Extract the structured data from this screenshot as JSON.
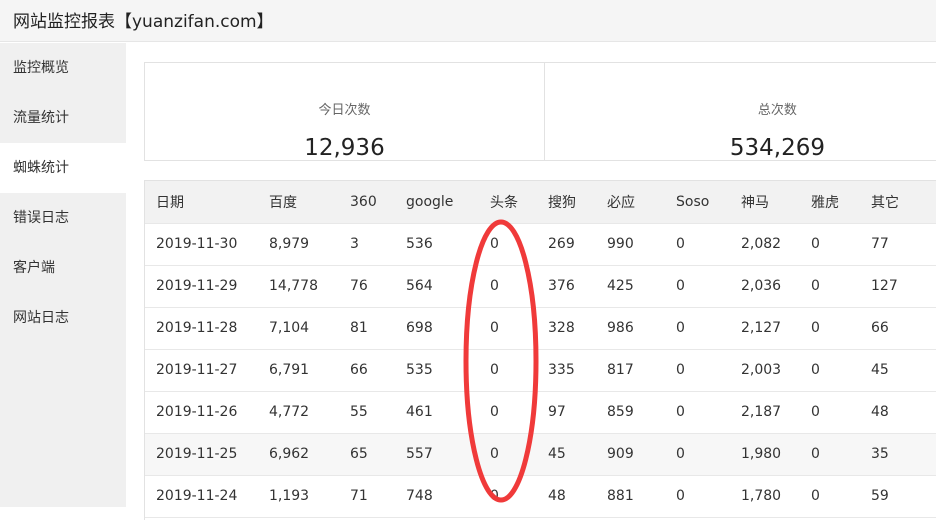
{
  "header": {
    "title": "网站监控报表【yuanzifan.com】"
  },
  "sidebar": {
    "items": [
      {
        "label": "监控概览"
      },
      {
        "label": "流量统计"
      },
      {
        "label": "蜘蛛统计"
      },
      {
        "label": "错误日志"
      },
      {
        "label": "客户端"
      },
      {
        "label": "网站日志"
      }
    ],
    "active_index": 2
  },
  "stats": {
    "today": {
      "label": "今日次数",
      "value": "12,936"
    },
    "total": {
      "label": "总次数",
      "value": "534,269"
    }
  },
  "table": {
    "columns": [
      "日期",
      "百度",
      "360",
      "google",
      "头条",
      "搜狗",
      "必应",
      "Soso",
      "神马",
      "雅虎",
      "其它"
    ],
    "rows": [
      [
        "2019-11-30",
        "8,979",
        "3",
        "536",
        "0",
        "269",
        "990",
        "0",
        "2,082",
        "0",
        "77"
      ],
      [
        "2019-11-29",
        "14,778",
        "76",
        "564",
        "0",
        "376",
        "425",
        "0",
        "2,036",
        "0",
        "127"
      ],
      [
        "2019-11-28",
        "7,104",
        "81",
        "698",
        "0",
        "328",
        "986",
        "0",
        "2,127",
        "0",
        "66"
      ],
      [
        "2019-11-27",
        "6,791",
        "66",
        "535",
        "0",
        "335",
        "817",
        "0",
        "2,003",
        "0",
        "45"
      ],
      [
        "2019-11-26",
        "4,772",
        "55",
        "461",
        "0",
        "97",
        "859",
        "0",
        "2,187",
        "0",
        "48"
      ],
      [
        "2019-11-25",
        "6,962",
        "65",
        "557",
        "0",
        "45",
        "909",
        "0",
        "1,980",
        "0",
        "35"
      ],
      [
        "2019-11-24",
        "1,193",
        "71",
        "748",
        "0",
        "48",
        "881",
        "0",
        "1,780",
        "0",
        "59"
      ]
    ]
  },
  "annotation": {
    "color": "#f03a3a"
  },
  "colors": {
    "header_bg": "#f5f5f5",
    "sidebar_bg": "#f0f0f0",
    "active_item_bg": "#ffffff",
    "table_head_bg": "#f2f2f2"
  }
}
